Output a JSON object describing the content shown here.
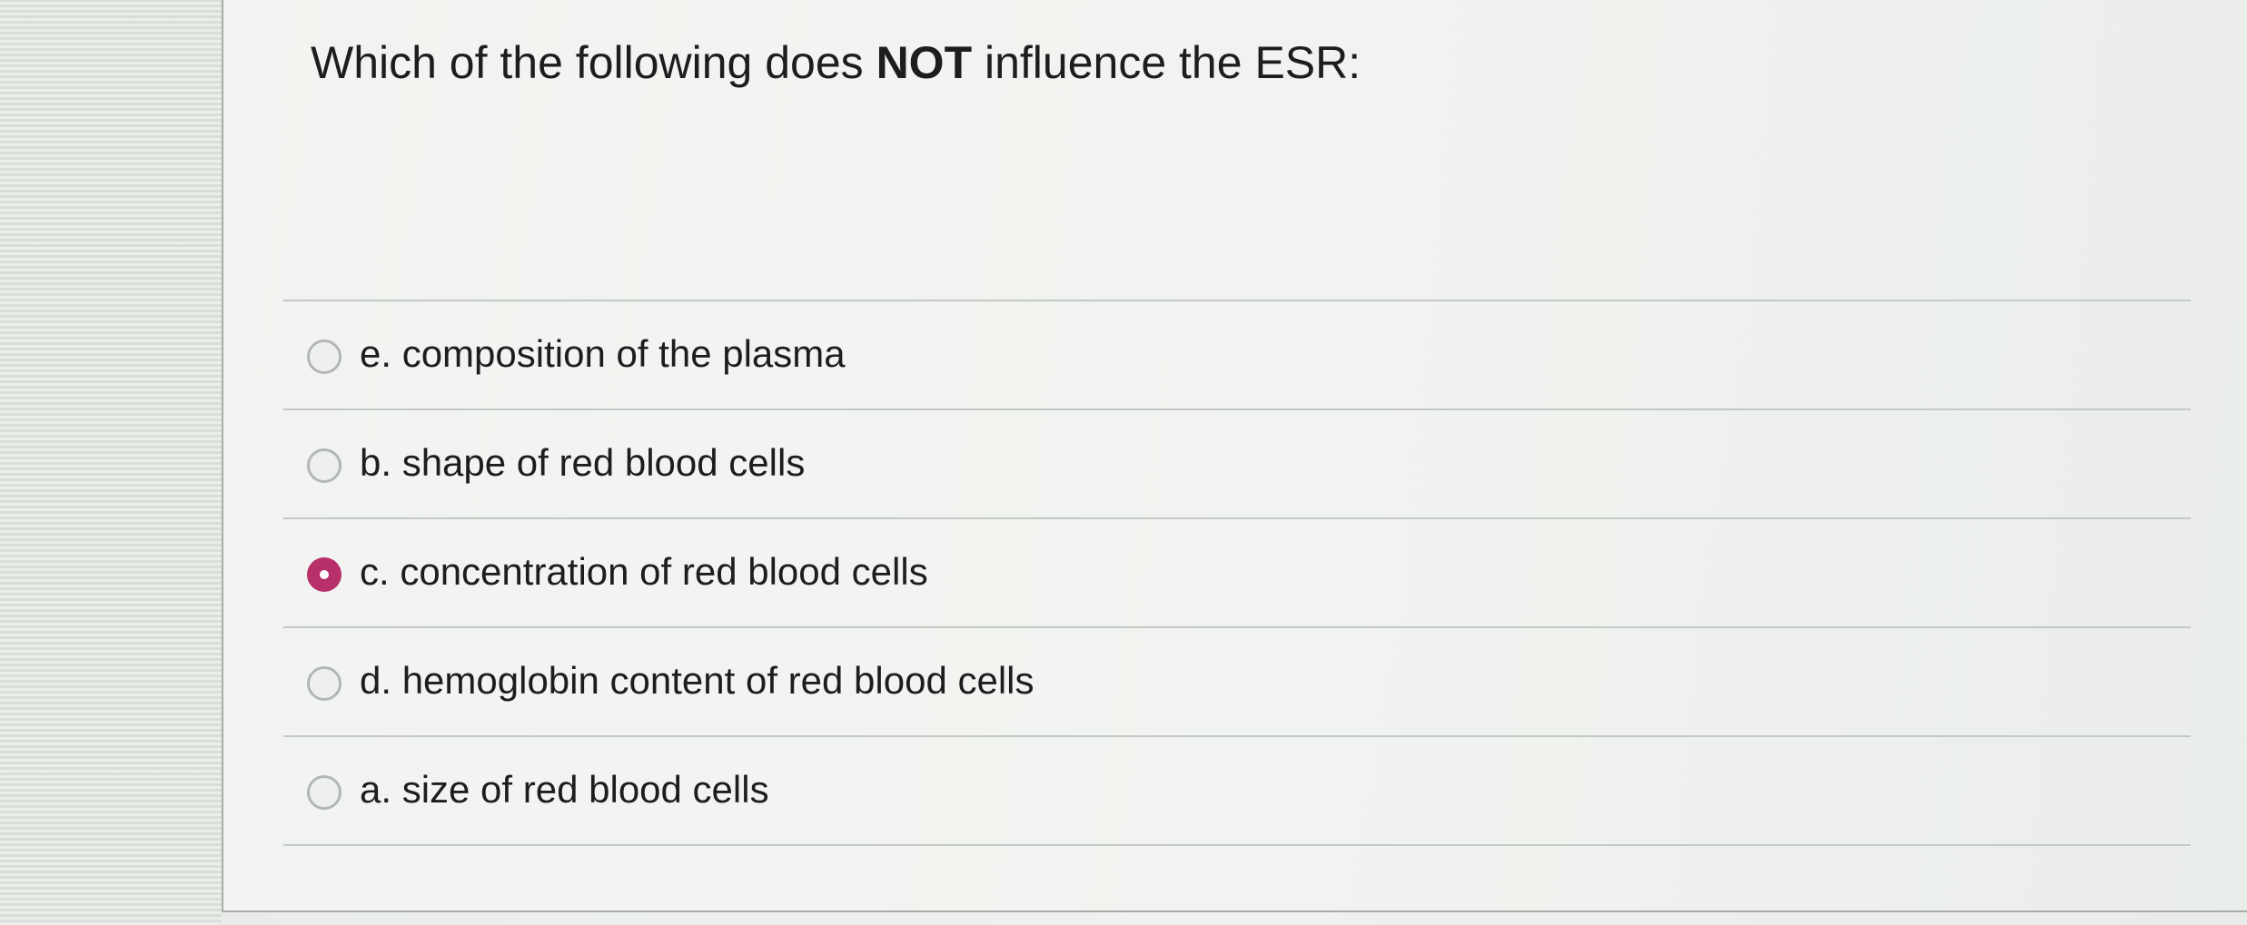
{
  "question": {
    "prefix": "Which of the following does ",
    "emphasis": "NOT",
    "suffix": " influence the ESR:"
  },
  "options": [
    {
      "label": "e. composition of the plasma",
      "selected": false
    },
    {
      "label": "b. shape of red blood cells",
      "selected": false
    },
    {
      "label": "c. concentration of red blood cells",
      "selected": true
    },
    {
      "label": "d. hemoglobin content of red blood cells",
      "selected": false
    },
    {
      "label": "a. size of red blood cells",
      "selected": false
    }
  ],
  "colors": {
    "selected_radio": "#b8306a",
    "text": "#1d1d1f",
    "divider": "#c5c9c5"
  }
}
